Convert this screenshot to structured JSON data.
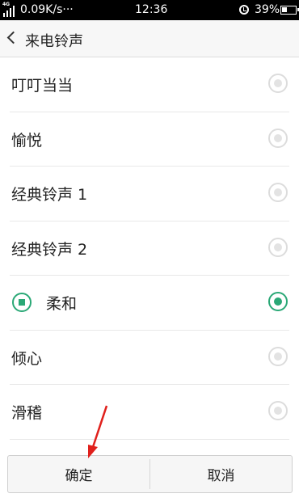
{
  "status_bar": {
    "network": "4G",
    "speed": "0.09K/s",
    "more": "···",
    "time": "12:36",
    "battery": "39%",
    "battery_level": 0.39
  },
  "header": {
    "title": "来电铃声"
  },
  "ringtones": [
    {
      "label": "叮叮当当",
      "selected": false,
      "playing": false
    },
    {
      "label": "愉悦",
      "selected": false,
      "playing": false
    },
    {
      "label": "经典铃声 1",
      "selected": false,
      "playing": false
    },
    {
      "label": "经典铃声 2",
      "selected": false,
      "playing": false
    },
    {
      "label": "柔和",
      "selected": true,
      "playing": true
    },
    {
      "label": "倾心",
      "selected": false,
      "playing": false
    },
    {
      "label": "滑稽",
      "selected": false,
      "playing": false
    }
  ],
  "buttons": {
    "confirm": "确定",
    "cancel": "取消"
  },
  "colors": {
    "accent": "#2aa876",
    "annotation_arrow": "#e0201c"
  }
}
